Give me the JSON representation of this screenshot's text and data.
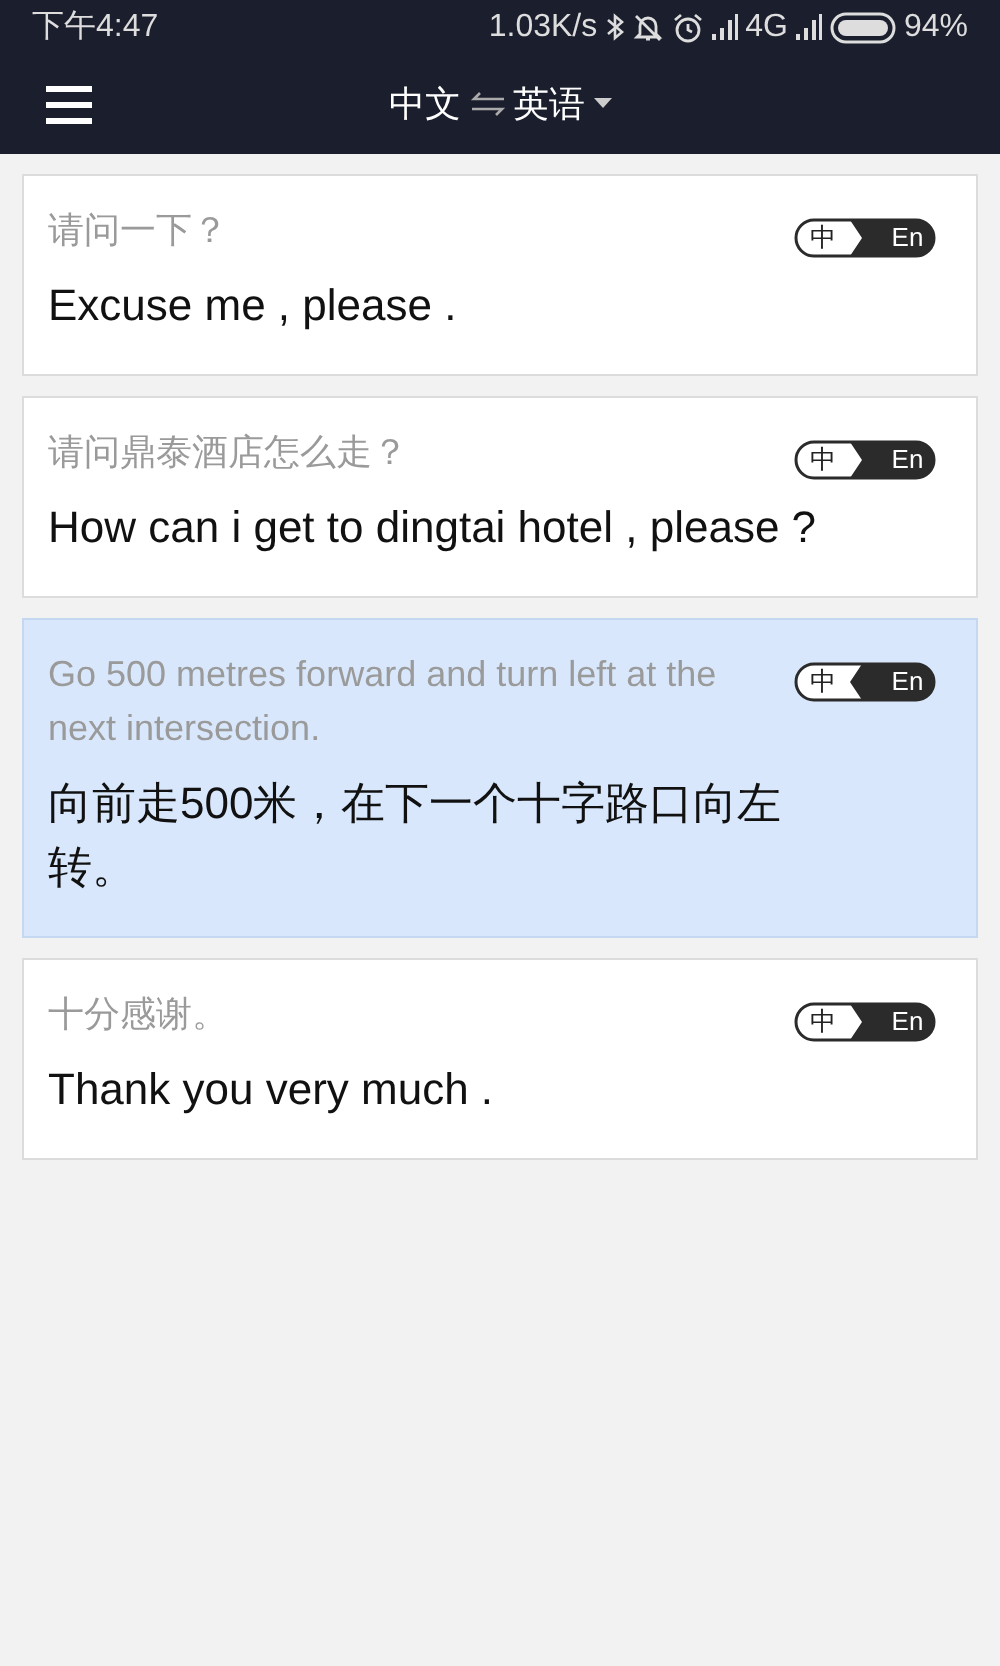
{
  "status_bar": {
    "time": "下午4:47",
    "network_speed": "1.03K/s",
    "network_type": "4G",
    "battery": "94%"
  },
  "header": {
    "source_language": "中文",
    "target_language": "英语"
  },
  "cards": [
    {
      "source": "请问一下？",
      "translation": "Excuse me , please .",
      "selected": false,
      "kind": "zh_to_en",
      "toggle": [
        "中",
        "En"
      ]
    },
    {
      "source": "请问鼎泰酒店怎么走？",
      "translation": "How can i get to dingtai hotel , please ?",
      "selected": false,
      "kind": "zh_to_en",
      "toggle": [
        "中",
        "En"
      ]
    },
    {
      "source": "Go 500 metres forward and turn left at the next intersection.",
      "translation": "向前走500米，在下一个十字路口向左转。",
      "selected": true,
      "kind": "en_to_zh",
      "toggle": [
        "中",
        "En"
      ]
    },
    {
      "source": "十分感谢。",
      "translation": "Thank you very much .",
      "selected": false,
      "kind": "zh_to_en",
      "toggle": [
        "中",
        "En"
      ]
    }
  ]
}
